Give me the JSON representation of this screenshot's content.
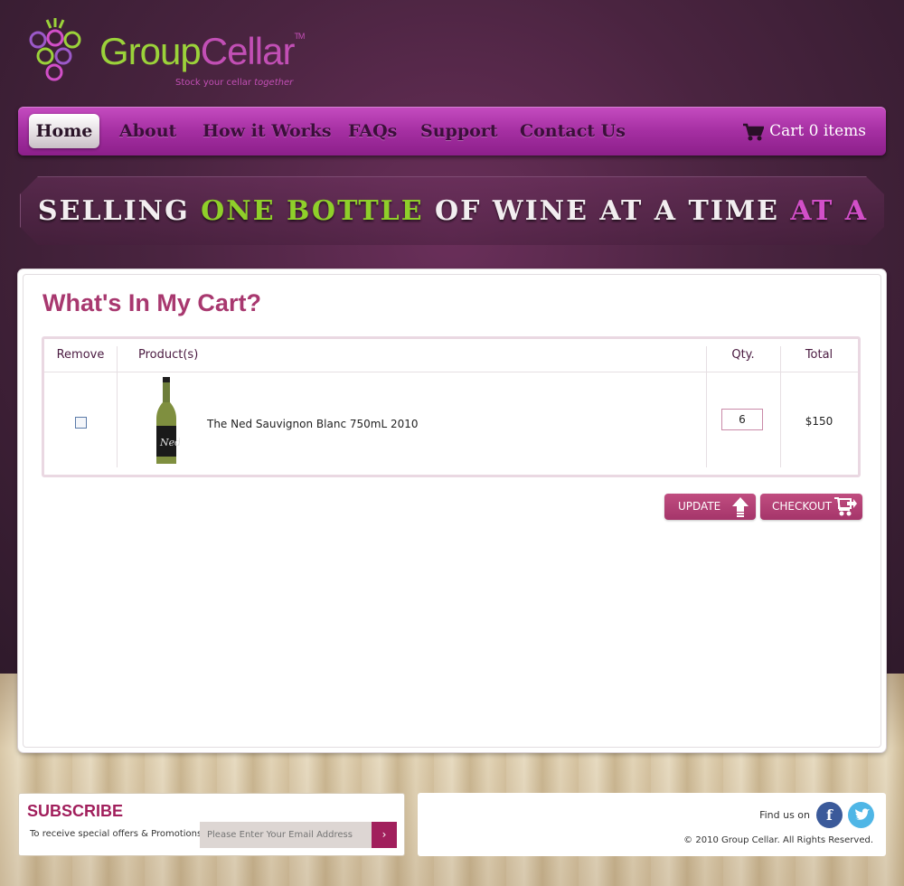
{
  "brand": {
    "name_part1": "Group",
    "name_part2": "Cellar",
    "tm": "TM",
    "tagline": "Stock your cellar",
    "tagline_em": "together"
  },
  "nav": {
    "items": [
      "Home",
      "About",
      "How it Works",
      "FAQs",
      "Support",
      "Contact Us"
    ],
    "active": "Home",
    "cart_label": "Cart 0 items"
  },
  "banner": {
    "part1": "SELLING ",
    "part2": "ONE BOTTLE",
    "part3": " OF WINE AT A TIME ",
    "part4": "AT A GROUP RATE"
  },
  "cart": {
    "title": "What's In My Cart?",
    "columns": {
      "remove": "Remove",
      "product": "Product(s)",
      "qty": "Qty.",
      "total": "Total"
    },
    "rows": [
      {
        "product": "The Ned Sauvignon Blanc 750mL 2010",
        "qty": "6",
        "total": "$150",
        "remove_checked": false
      }
    ],
    "update_label": "UPDATE",
    "checkout_label": "CHECKOUT"
  },
  "footer": {
    "subscribe_title": "SUBSCRIBE",
    "subscribe_desc": "To receive special offers & Promotions",
    "email_placeholder": "Please Enter Your Email Address",
    "submit_glyph": "›",
    "find_us": "Find us on",
    "copyright": "© 2010 Group Cellar. All Rights Reserved."
  },
  "colors": {
    "accent": "#a8386f",
    "nav": "#a52fa2",
    "green": "#8fcf2a",
    "pink": "#d24fc8"
  },
  "icons": [
    "grapes-logo-icon",
    "cart-icon",
    "upload-arrow-icon",
    "checkout-cart-icon",
    "facebook-icon",
    "twitter-icon",
    "arrow-right-icon"
  ]
}
